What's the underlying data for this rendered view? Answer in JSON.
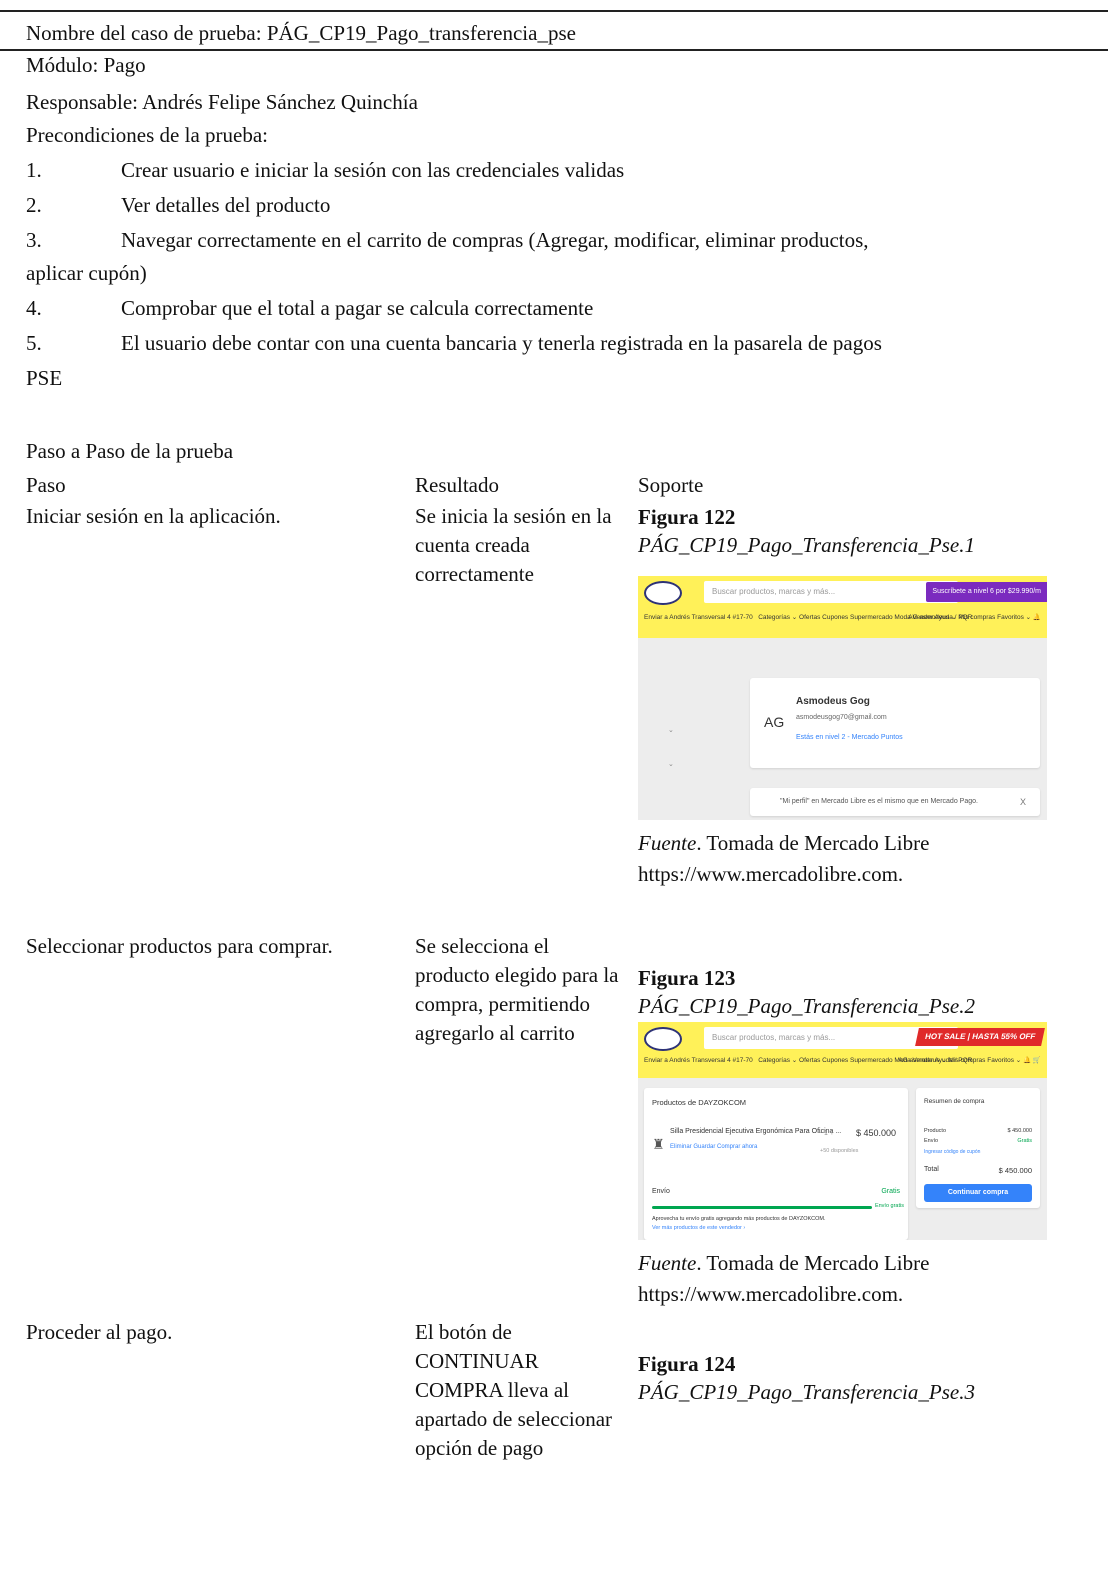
{
  "header": {
    "test_case_name": "Nombre del caso de prueba: PÁG_CP19_Pago_transferencia_pse",
    "module": "Módulo: Pago",
    "responsible": "Responsable: Andrés Felipe Sánchez Quinchía",
    "preconditions_title": "Precondiciones de la prueba:"
  },
  "preconditions": [
    {
      "num": "1.",
      "text": "Crear usuario e iniciar la sesión con las credenciales validas"
    },
    {
      "num": "2.",
      "text": "Ver detalles del producto"
    },
    {
      "num": "3.",
      "text": "Navegar correctamente en el carrito de compras (Agregar, modificar, eliminar productos,",
      "cont": "aplicar cupón)"
    },
    {
      "num": "4.",
      "text": "Comprobar que el total a pagar se calcula correctamente"
    },
    {
      "num": "5.",
      "text": "El usuario debe contar con una cuenta bancaria y tenerla registrada en la pasarela de pagos",
      "cont": "PSE"
    }
  ],
  "steps_section": {
    "title": "Paso a Paso de la prueba",
    "col_step": "Paso",
    "col_result": "Resultado",
    "col_support": "Soporte"
  },
  "steps": [
    {
      "step": "Iniciar sesión en la aplicación.",
      "result": "Se inicia la sesión en la cuenta creada correctamente",
      "figure_label": "Figura 122",
      "figure_title": "PÁG_CP19_Pago_Transferencia_Pse.1",
      "source_label": "Fuente",
      "source_text": ". Tomada de Mercado Libre",
      "source_url": "https://www.mercadolibre.com."
    },
    {
      "step": "Seleccionar productos para comprar.",
      "result": "Se selecciona el producto elegido para la compra, permitiendo agregarlo al carrito",
      "figure_label": "Figura 123",
      "figure_title": "PÁG_CP19_Pago_Transferencia_Pse.2",
      "source_label": "Fuente",
      "source_text": ". Tomada de Mercado Libre",
      "source_url": "https://www.mercadolibre.com."
    },
    {
      "step": "Proceder al pago.",
      "result": "El botón de CONTINUAR COMPRA lleva al apartado de seleccionar opción de pago",
      "figure_label": "Figura 124",
      "figure_title": "PÁG_CP19_Pago_Transferencia_Pse.3"
    }
  ],
  "shot1": {
    "logo": "mercado libre",
    "search_placeholder": "Buscar productos, marcas y más...",
    "banner": "Suscríbete a nivel 6 por $29.990/m",
    "location": "Enviar a Andrés Transversal 4 #17-70",
    "nav": "Categorías ⌄   Ofertas   Cupones   Supermercado   Moda   Vender   Ayuda / PQR",
    "nav_right": "AG asmodeus ⌄   Mis compras   Favoritos ⌄   🔔",
    "avatar": "AG",
    "name": "Asmodeus Gog",
    "email": "asmodeusgog70@gmail.com",
    "level": "Estás en nivel 2 - Mercado Puntos",
    "notice": "\"Mi perfil\" en Mercado Libre es el mismo que en Mercado Pago.",
    "close": "X"
  },
  "shot2": {
    "logo": "mercado libre",
    "search_placeholder": "Buscar productos, marcas y más...",
    "hotsale": "HOT SALE | HASTA 55% OFF",
    "location": "Enviar a Andrés Transversal 4 #17-70",
    "nav": "Categorías ⌄   Ofertas   Cupones   Supermercado   Moda   Vender   Ayuda / PQR",
    "nav_right": "AG asmodeus ⌄   Mis compras   Favoritos ⌄   🔔   🛒",
    "seller": "Productos de DAYZOKCOM",
    "product": "Silla Presidencial Ejecutiva Ergonómica Para Oficina ...",
    "actions": "Eliminar   Guardar   Comprar ahora",
    "qty": "−   1   +",
    "available": "+50 disponibles",
    "price": "$ 450.000",
    "shipping": "Envío",
    "shipping_value": "Gratis",
    "free_shipping": "Envío gratis",
    "promo": "Aprovecha tu envío gratis agregando más productos de DAYZOKCOM.",
    "more": "Ver más productos de este vendedor ›",
    "summary_title": "Resumen de compra",
    "sum_product": "Producto",
    "sum_product_value": "$ 450.000",
    "sum_shipping": "Envío",
    "sum_shipping_value": "Gratis",
    "coupon": "Ingresar código de cupón",
    "total_label": "Total",
    "total_value": "$ 450.000",
    "continue_button": "Continuar compra"
  }
}
